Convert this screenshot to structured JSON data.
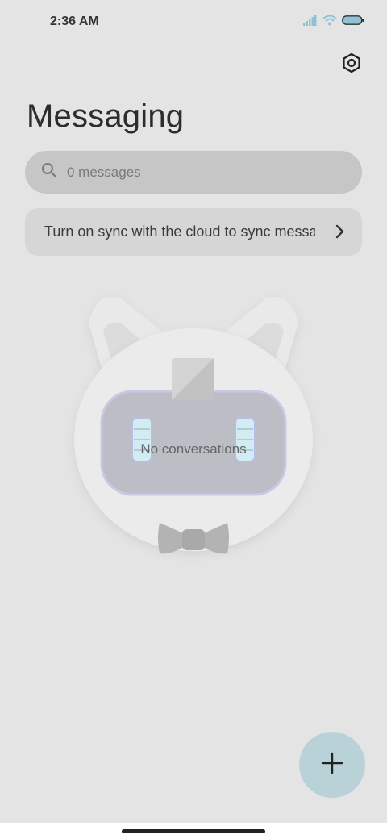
{
  "status_bar": {
    "time": "2:36 AM",
    "icons": [
      "signal-icon",
      "wifi-icon",
      "battery-icon"
    ]
  },
  "header": {
    "settings_icon": "gear-icon",
    "title": "Messaging"
  },
  "search": {
    "icon": "search-icon",
    "placeholder": "0 messages"
  },
  "sync_banner": {
    "text": "Turn on sync with the cloud to sync messa",
    "icon": "chevron-right-icon"
  },
  "empty_state": {
    "illustration": "robot-cat-mascot",
    "label": "No conversations"
  },
  "fab": {
    "icon": "plus-icon",
    "color": "#b9d2d8"
  },
  "colors": {
    "background": "#e4e4e4",
    "search_bg": "#c6c6c6",
    "banner_bg": "#d6d6d6",
    "accent": "#8ec3d6"
  }
}
